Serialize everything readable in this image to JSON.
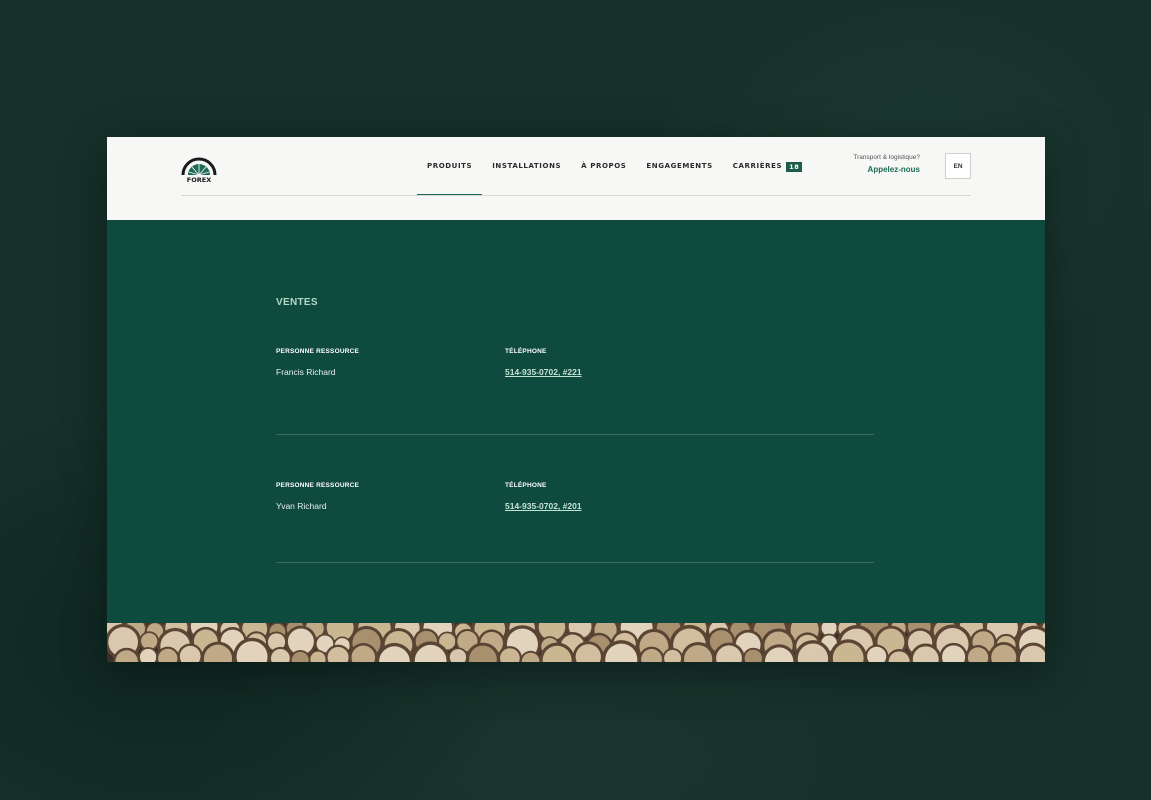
{
  "header": {
    "logo_text": "FOREX",
    "nav": [
      {
        "label": "PRODUITS",
        "active": true
      },
      {
        "label": "INSTALLATIONS",
        "active": false
      },
      {
        "label": "À PROPOS",
        "active": false
      },
      {
        "label": "ENGAGEMENTS",
        "active": false
      },
      {
        "label": "CARRIÈRES",
        "active": false,
        "badge": "18"
      }
    ],
    "transport_question": "Transport & logistique?",
    "call_label": "Appelez-nous",
    "language": "EN"
  },
  "sales": {
    "title": "VENTES",
    "contacts": [
      {
        "person_label": "PERSONNE RESSOURCE",
        "person": "Francis Richard",
        "phone_label": "TÉLÉPHONE",
        "phone": "514-935-0702, #221"
      },
      {
        "person_label": "PERSONNE RESSOURCE",
        "person": "Yvan Richard",
        "phone_label": "TÉLÉPHONE",
        "phone": "514-935-0702, #201"
      }
    ]
  },
  "colors": {
    "accent": "#1d6b55",
    "content_bg": "#0f4a3f",
    "header_bg": "#f7f7f6"
  },
  "icons": {
    "logo": "forex-logo-icon"
  }
}
